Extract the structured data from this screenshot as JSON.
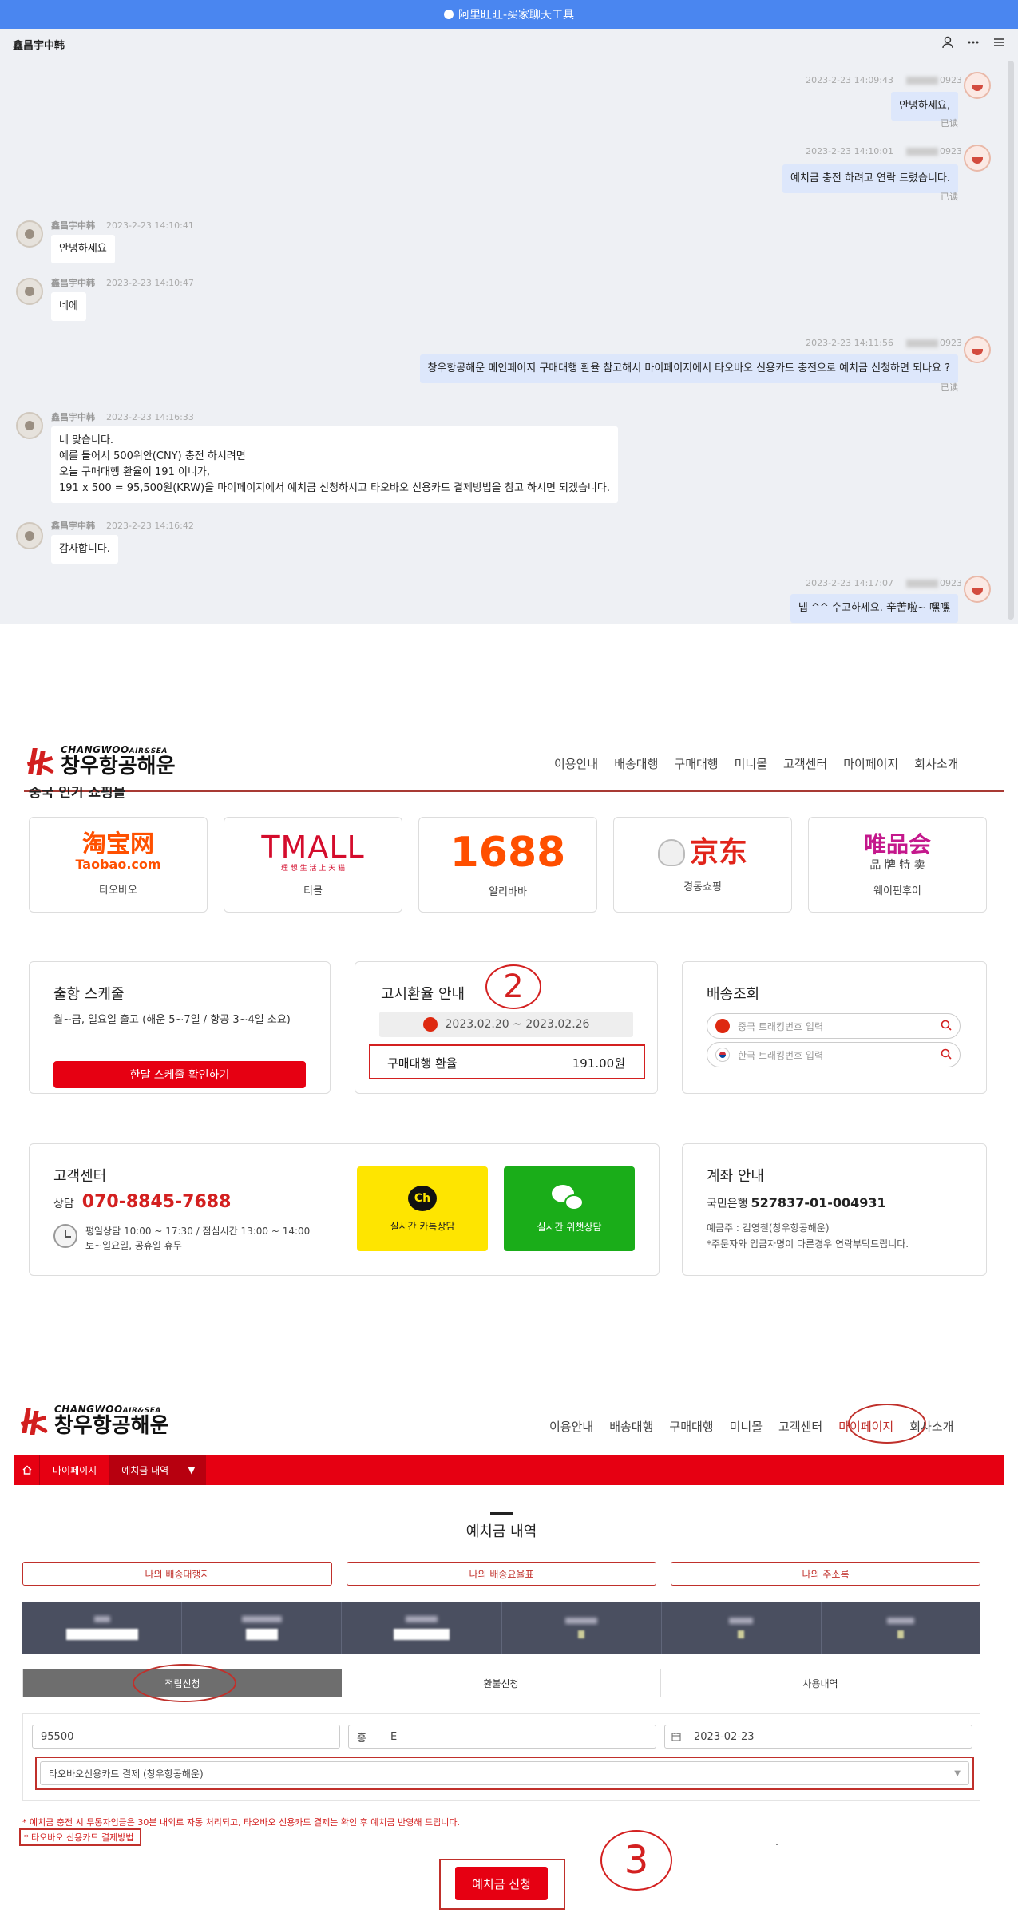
{
  "titlebar": {
    "title": "阿里旺旺-买家聊天工具"
  },
  "chat": {
    "contact_name": "鑫昌宇中韩",
    "my_suffix": "0923",
    "read_label": "已读",
    "messages": [
      {
        "side": "right",
        "time": "2023-2-23 14:09:43",
        "text": "안녕하세요,"
      },
      {
        "side": "right",
        "time": "2023-2-23 14:10:01",
        "text": "예치금 충전 하려고 연락 드렸습니다."
      },
      {
        "side": "left",
        "time": "2023-2-23 14:10:41",
        "text": "안녕하세요"
      },
      {
        "side": "left",
        "time": "2023-2-23 14:10:47",
        "text": "네에"
      },
      {
        "side": "right",
        "time": "2023-2-23 14:11:56",
        "text": "창우항공해운 메인페이지 구매대행 환율 참고해서 마이페이지에서 타오바오 신용카드 충전으로 예치금 신청하면 되나요 ?"
      },
      {
        "side": "left",
        "time": "2023-2-23 14:16:33",
        "text": "네 맞습니다.\n예를 들어서 500위안(CNY) 충전 하시려면\n오늘 구매대행 환율이 191 이니가,\n191 x 500 = 95,500원(KRW)을 마이페이지에서 예치금 신청하시고 타오바오 신용카드 결제방법을 참고 하시면 되겠습니다."
      },
      {
        "side": "left",
        "time": "2023-2-23 14:16:42",
        "text": "감사합니다."
      },
      {
        "side": "right",
        "time": "2023-2-23 14:17:07",
        "text": "넵 ^^ 수고하세요. 辛苦啦~ 嘿嘿"
      }
    ]
  },
  "site": {
    "logo_en": "CHANGWOO",
    "logo_en_suffix": "AIR&SEA",
    "logo_ko": "창우항공해운",
    "nav": [
      "이용안내",
      "배송대행",
      "구매대행",
      "미니몰",
      "고객센터",
      "마이페이지",
      "회사소개"
    ],
    "section_cut_title": "중국 인기 쇼핑몰",
    "shops": [
      {
        "logo": "淘宝网",
        "sub": "Taobao.com",
        "label": "타오바오",
        "color": "#ff5000"
      },
      {
        "logo": "TMALL",
        "sub": "理 想 生 活 上 天 猫",
        "label": "티몰",
        "color": "#d40c2c"
      },
      {
        "logo": "1688",
        "sub": "",
        "label": "알리바바",
        "color": "#ff4f00"
      },
      {
        "logo": "京东",
        "sub": "",
        "label": "경동쇼핑",
        "color": "#e1251b"
      },
      {
        "logo": "唯品会",
        "sub": "品 牌 特 卖",
        "label": "웨이핀후이",
        "color": "#c4188c"
      }
    ],
    "schedule": {
      "title": "출항 스케줄",
      "text": "월~금, 일요일 출고 (해운 5~7일 / 항공 3~4일 소요)",
      "button": "한달 스케줄 확인하기"
    },
    "rate": {
      "title": "고시환율 안내",
      "period": "2023.02.20 ~ 2023.02.26",
      "label": "구매대행 환율",
      "value": "191.00원",
      "annotation": "2"
    },
    "tracking": {
      "title": "배송조회",
      "cn_placeholder": "중국 트래킹번호 입력",
      "kr_placeholder": "한국 트래킹번호 입력"
    },
    "customer": {
      "title": "고객센터",
      "phone_label": "상담",
      "phone": "070-8845-7688",
      "hours1": "평일상담 10:00 ~ 17:30 / 점심시간 13:00 ~ 14:00",
      "hours2": "토~일요일, 공휴일 휴무",
      "kakao": "실시간 카톡상담",
      "wechat": "실시간 위챗상담",
      "kakao_badge": "Ch"
    },
    "account": {
      "title": "계좌 안내",
      "bank": "국민은행",
      "number": "527837-01-004931",
      "holder": "예금주 : 김영철(창우항공해운)",
      "note": "*주문자와 입금자명이 다른경우 연락부탁드립니다."
    }
  },
  "mypage": {
    "breadcrumb": [
      "마이페이지",
      "예치금 내역"
    ],
    "title": "예치금 내역",
    "links": [
      "나의 배송대행지",
      "나의 배송요율표",
      "나의 주소록"
    ],
    "tabs": [
      "적립신청",
      "환불신청",
      "사용내역"
    ],
    "amount": "95500",
    "depositor_prefix": "홍",
    "depositor_suffix": "E",
    "date": "2023-02-23",
    "method": "타오바오신용카드 결제 (창우항공해운)",
    "notice": "* 예치금 충전 시 무통자입금은 30분 내외로 자동 처리되고, 타오바오 신용카드 결제는 확인 후 예치금 반영해 드립니다.",
    "guide_link": "* 타오바오 신용카드 결제방법",
    "submit": "예치금 신청",
    "annotation": "3"
  }
}
